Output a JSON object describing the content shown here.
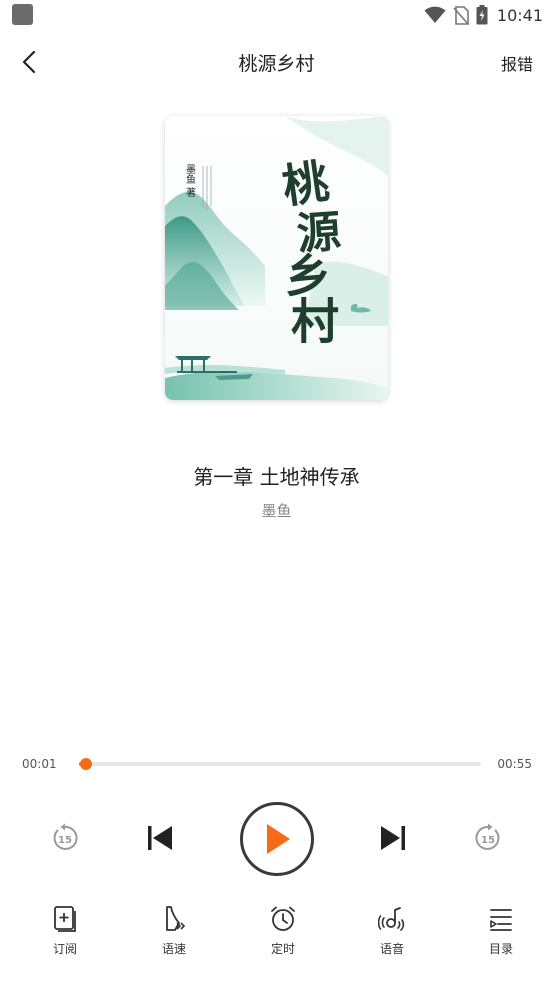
{
  "status_bar": {
    "time": "10:41",
    "icons": [
      "wifi-icon",
      "no-sim-icon",
      "battery-charging-icon"
    ]
  },
  "header": {
    "back_icon": "chevron-left-icon",
    "title": "桃源乡村",
    "report_label": "报错"
  },
  "cover": {
    "title_chars": [
      "桃",
      "源",
      "乡",
      "村"
    ],
    "author_mark": "墨鱼 著"
  },
  "track": {
    "chapter_title": "第一章 土地神传承",
    "author": "墨鱼"
  },
  "progress": {
    "current_time": "00:01",
    "total_time": "00:55",
    "fraction": 0.018
  },
  "controls": {
    "rewind_seconds": "15",
    "forward_seconds": "15",
    "accent_color": "#f46a17"
  },
  "toolbar": {
    "items": [
      {
        "icon": "subscribe-icon",
        "label": "订阅"
      },
      {
        "icon": "speed-icon",
        "label": "语速"
      },
      {
        "icon": "alarm-clock-icon",
        "label": "定时"
      },
      {
        "icon": "voice-icon",
        "label": "语音"
      },
      {
        "icon": "list-icon",
        "label": "目录"
      }
    ]
  }
}
